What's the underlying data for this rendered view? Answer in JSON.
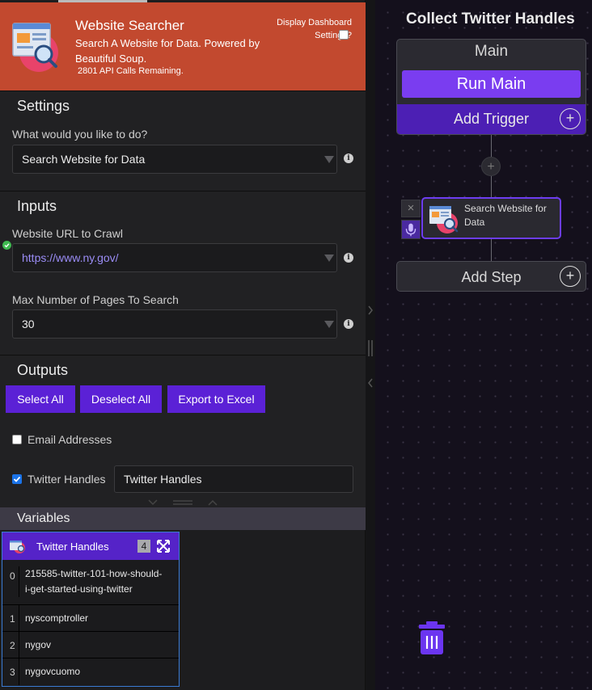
{
  "header": {
    "title": "Website Searcher",
    "description": "Search A Website for Data. Powered by Beautiful Soup.",
    "api_calls": "2801 API Calls Remaining.",
    "dashboard_label": "Display Dashboard Settings?",
    "dashboard_checked": false
  },
  "settings": {
    "title": "Settings",
    "action_label": "What would you like to do?",
    "action_value": "Search Website for Data"
  },
  "inputs": {
    "title": "Inputs",
    "url_label": "Website URL to Crawl",
    "url_value": "https://www.ny.gov/",
    "pages_label": "Max Number of Pages To Search",
    "pages_value": "30"
  },
  "outputs": {
    "title": "Outputs",
    "select_all": "Select All",
    "deselect_all": "Deselect All",
    "export_excel": "Export to Excel",
    "items": [
      {
        "label": "Email Addresses",
        "checked": false
      },
      {
        "label": "Twitter Handles",
        "checked": true,
        "value": "Twitter Handles"
      }
    ]
  },
  "variables": {
    "title": "Variables",
    "card_title": "Twitter Handles",
    "count": "4",
    "rows": [
      {
        "index": "0",
        "value": "215585-twitter-101-how-should-i-get-started-using-twitter"
      },
      {
        "index": "1",
        "value": "nyscomptroller"
      },
      {
        "index": "2",
        "value": "nygov"
      },
      {
        "index": "3",
        "value": "nygovcuomo"
      }
    ]
  },
  "flow": {
    "title": "Collect Twitter Handles",
    "main_label": "Main",
    "run_main": "Run Main",
    "add_trigger": "Add Trigger",
    "step_label": "Search Website for Data",
    "add_step": "Add Step"
  },
  "colors": {
    "header_bg": "#c2492f",
    "primary_button": "#5b21d6",
    "run_main": "#7a3df0",
    "add_trigger": "#4c1fb4",
    "canvas_bg": "#14101c"
  }
}
